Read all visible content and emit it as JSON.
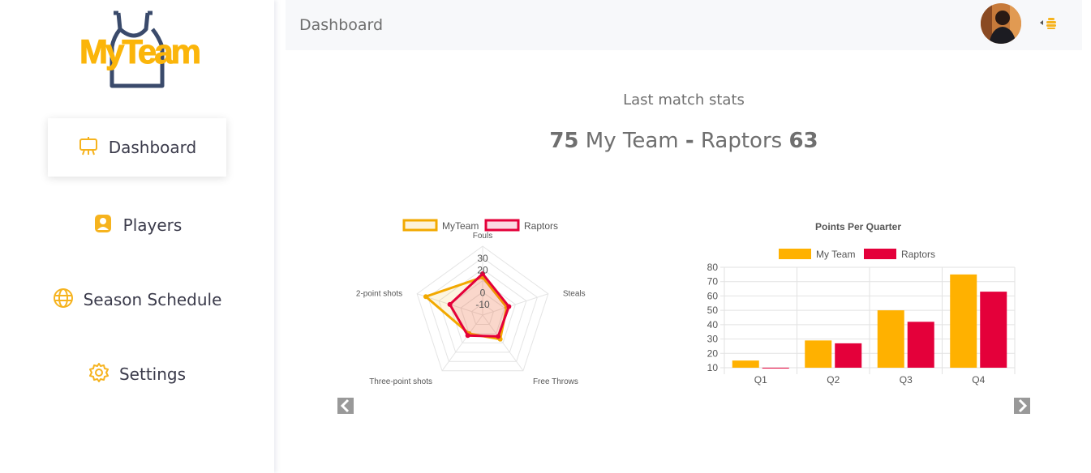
{
  "brand": {
    "logo_text": "MyTeam",
    "accent": "#fbb50a",
    "dark": "#3a4a6b"
  },
  "sidebar": {
    "items": [
      {
        "label": "Dashboard",
        "icon": "easel-icon",
        "active": true
      },
      {
        "label": "Players",
        "icon": "player-badge-icon",
        "active": false
      },
      {
        "label": "Season Schedule",
        "icon": "globe-icon",
        "active": false
      },
      {
        "label": "Settings",
        "icon": "gear-icon",
        "active": false
      }
    ]
  },
  "header": {
    "title": "Dashboard"
  },
  "main": {
    "stats_title": "Last match stats",
    "score": {
      "home_score": "75",
      "home_team": "My Team",
      "separator": "-",
      "away_team": "Raptors",
      "away_score": "63"
    }
  },
  "chart_data": [
    {
      "type": "radar",
      "title": "",
      "axes": [
        "Fouls",
        "Steals",
        "Free Throws",
        "Three-point shots",
        "2-point shots"
      ],
      "tick_labels": [
        "30",
        "20",
        "0",
        "-10"
      ],
      "scale": {
        "min": -20,
        "max": 40
      },
      "series": [
        {
          "name": "MyTeam",
          "color": "#f2a900",
          "values": [
            13,
            2,
            6,
            0,
            32
          ]
        },
        {
          "name": "Raptors",
          "color": "#e4003a",
          "values": [
            16,
            4,
            3,
            2,
            10
          ]
        }
      ],
      "legend": "top"
    },
    {
      "type": "bar",
      "title": "Points Per Quarter",
      "categories": [
        "Q1",
        "Q2",
        "Q3",
        "Q4"
      ],
      "series": [
        {
          "name": "My Team",
          "color": "#ffb100",
          "values": [
            15,
            29,
            50,
            75
          ]
        },
        {
          "name": "Raptors",
          "color": "#e4003a",
          "values": [
            0,
            27,
            42,
            63
          ]
        }
      ],
      "y_ticks": [
        "80",
        "70",
        "60",
        "50",
        "40",
        "30",
        "20",
        "10"
      ],
      "ylim": [
        10,
        80
      ],
      "grid": true,
      "legend": "top"
    }
  ]
}
